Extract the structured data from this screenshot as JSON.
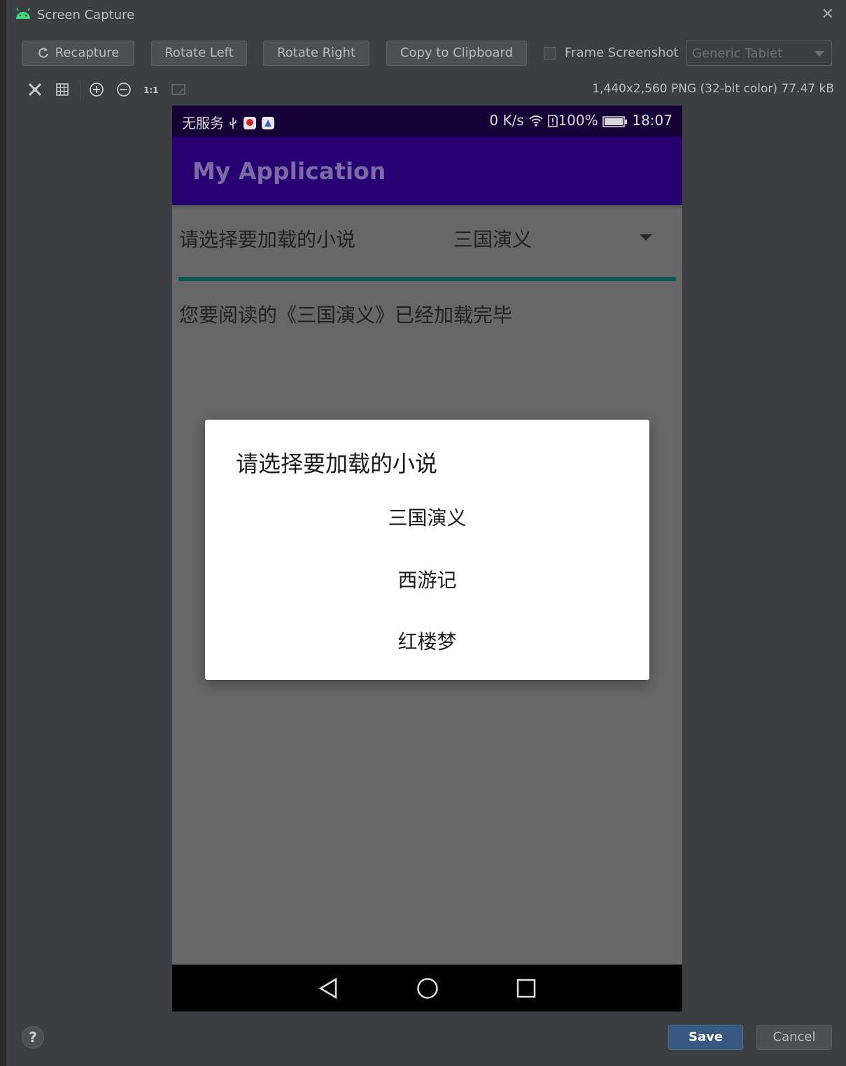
{
  "window": {
    "title": "Screen Capture",
    "close_icon": "close-icon"
  },
  "toolbar": {
    "recapture": "Recapture",
    "rotate_left": "Rotate Left",
    "rotate_right": "Rotate Right",
    "copy": "Copy to Clipboard",
    "frame_screenshot": "Frame Screenshot",
    "frame_screenshot_checked": false,
    "device": "Generic Tablet"
  },
  "view_tools": [
    "fit-icon",
    "grid-icon",
    "zoom-in-icon",
    "zoom-out-icon",
    "actual-size-icon",
    "frame-icon"
  ],
  "image_info": "1,440x2,560 PNG (32-bit color) 77.47 kB",
  "phone": {
    "status": {
      "carrier": "无服务",
      "speed": "0 K/s",
      "battery": "100%",
      "time": "18:07"
    },
    "app_title": "My Application",
    "spinner": {
      "label": "请选择要加载的小说",
      "value": "三国演义"
    },
    "message": "您要阅读的《三国演义》已经加载完毕",
    "dialog": {
      "title": "请选择要加载的小说",
      "options": [
        "三国演义",
        "西游记",
        "红楼梦"
      ]
    },
    "nav": [
      "back-icon",
      "home-icon",
      "recents-icon"
    ]
  },
  "footer": {
    "help": "?",
    "save": "Save",
    "cancel": "Cancel"
  },
  "colors": {
    "accent": "#365880",
    "app_bar": "#260071",
    "status_bar": "#150035",
    "progress": "#0c5a53"
  }
}
